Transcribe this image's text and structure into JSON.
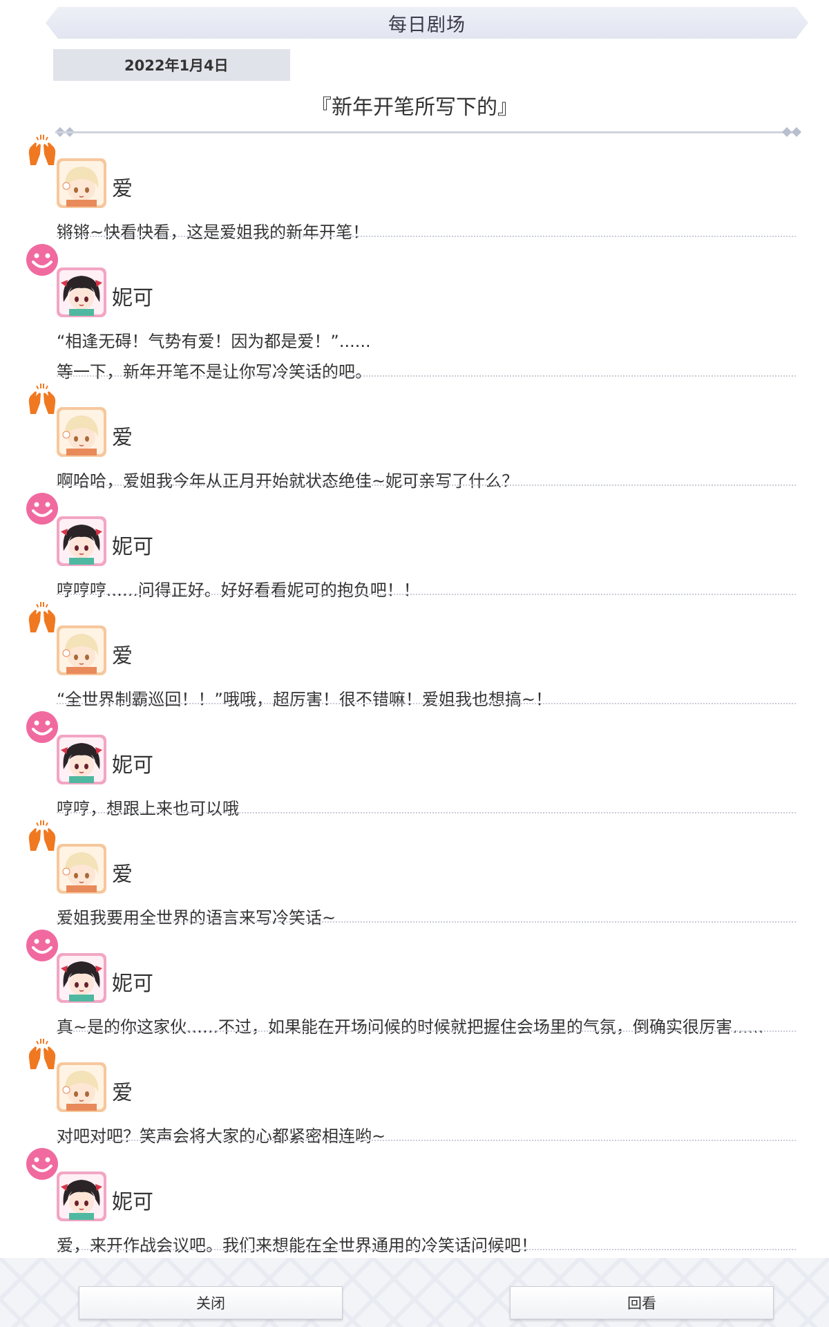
{
  "header": {
    "title": "每日剧场"
  },
  "story": {
    "date": "2022年1月4日",
    "title": "『新年开笔所写下的』"
  },
  "colors": {
    "ai_emote": "#f07820",
    "nico_emote": "#f06aa0",
    "ai_avatar_bg": "#f6c79c",
    "nico_avatar_bg": "#f2a6c4"
  },
  "messages": [
    {
      "speaker": "爱",
      "emote_icon": "raised-hands-icon",
      "lines": [
        "锵锵~快看快看，这是爱姐我的新年开笔！"
      ]
    },
    {
      "speaker": "妮可",
      "emote_icon": "smiley-icon",
      "lines": [
        "“相逢无碍！气势有爱！因为都是爱！”......",
        "等一下，新年开笔不是让你写冷笑话的吧。"
      ]
    },
    {
      "speaker": "爱",
      "emote_icon": "raised-hands-icon",
      "lines": [
        "啊哈哈，爱姐我今年从正月开始就状态绝佳~妮可亲写了什么？"
      ]
    },
    {
      "speaker": "妮可",
      "emote_icon": "smiley-icon",
      "lines": [
        "哼哼哼......问得正好。好好看看妮可的抱负吧！！"
      ]
    },
    {
      "speaker": "爱",
      "emote_icon": "raised-hands-icon",
      "lines": [
        "“全世界制霸巡回！！”哦哦，超厉害！很不错嘛！爱姐我也想搞~！"
      ]
    },
    {
      "speaker": "妮可",
      "emote_icon": "smiley-icon",
      "lines": [
        "哼哼，想跟上来也可以哦"
      ]
    },
    {
      "speaker": "爱",
      "emote_icon": "raised-hands-icon",
      "lines": [
        "爱姐我要用全世界的语言来写冷笑话~"
      ]
    },
    {
      "speaker": "妮可",
      "emote_icon": "smiley-icon",
      "lines": [
        "真~是的你这家伙......不过，如果能在开场问候的时候就把握住会场里的气氛，倒确实很厉害......"
      ]
    },
    {
      "speaker": "爱",
      "emote_icon": "raised-hands-icon",
      "lines": [
        "对吧对吧？笑声会将大家的心都紧密相连哟~"
      ]
    },
    {
      "speaker": "妮可",
      "emote_icon": "smiley-icon",
      "lines": [
        "爱，来开作战会议吧。我们来想能在全世界通用的冷笑话问候吧！"
      ]
    }
  ],
  "buttons": {
    "close_label": "关闭",
    "review_label": "回看"
  }
}
